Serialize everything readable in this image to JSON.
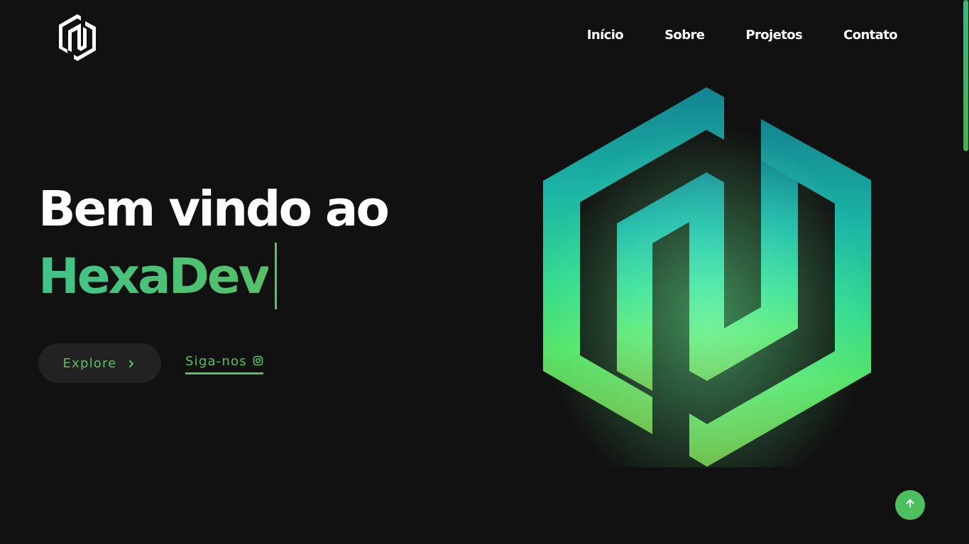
{
  "header": {
    "logo_icon": "hexadev-logo-icon",
    "nav": [
      {
        "label": "Início"
      },
      {
        "label": "Sobre"
      },
      {
        "label": "Projetos"
      },
      {
        "label": "Contato"
      }
    ]
  },
  "hero": {
    "line1": "Bem vindo ao",
    "line2": "HexaDev",
    "explore_label": "Explore",
    "follow_label": "Siga-nos",
    "explore_icon": "chevron-right-icon",
    "follow_icon": "instagram-icon"
  },
  "graphic": {
    "icon": "hexadev-logo-icon"
  },
  "to_top": {
    "icon": "arrow-up-icon"
  },
  "colors": {
    "background": "#111111",
    "accent": "#56c15f",
    "accent_teal": "#2bbfa0",
    "button_bg": "#222222",
    "text": "#ffffff"
  }
}
